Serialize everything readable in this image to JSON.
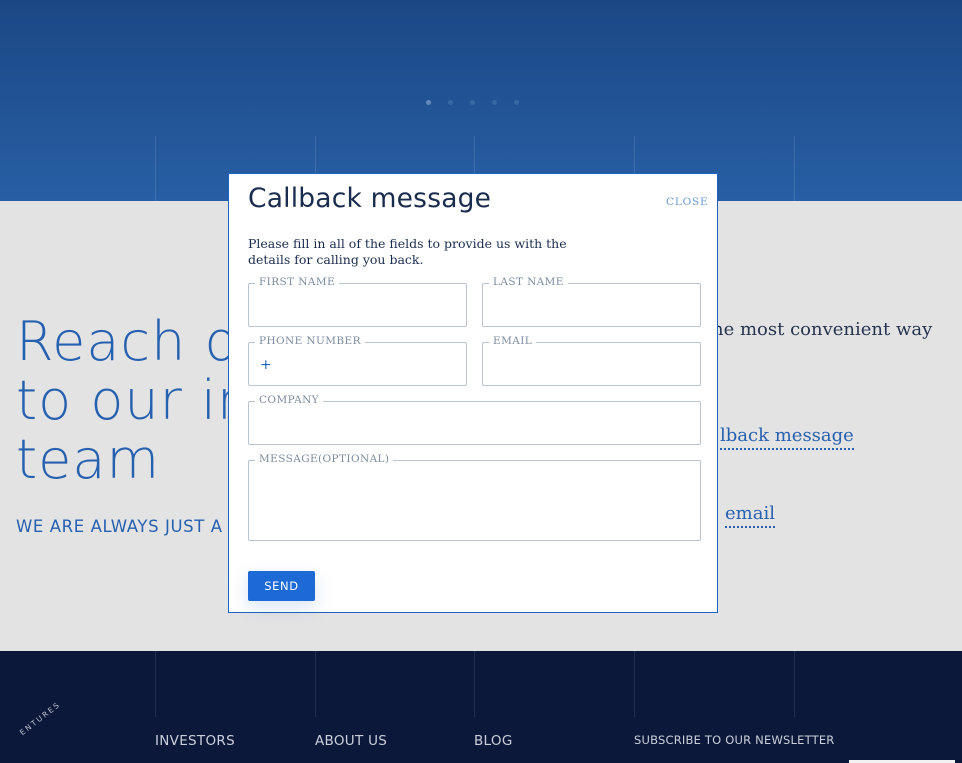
{
  "hero": {
    "slider_dots": [
      {
        "label": "slide-1",
        "active": true
      },
      {
        "label": "slide-2",
        "active": false
      },
      {
        "label": "slide-3",
        "active": false
      },
      {
        "label": "slide-4",
        "active": false
      },
      {
        "label": "slide-5",
        "active": false
      }
    ]
  },
  "contact_section": {
    "title": "Reach ou\nto our inv\nteam",
    "subtitle": "WE ARE ALWAYS JUST A C",
    "convenient_text": "he most convenient way",
    "callback_link": "lback message",
    "email_link": "email"
  },
  "modal": {
    "title": "Callback message",
    "close_label": "CLOSE",
    "description": "Please fill in all of the fields to provide us with the details for calling you back.",
    "fields": {
      "first_name": {
        "label": "FIRST NAME",
        "value": ""
      },
      "last_name": {
        "label": "LAST NAME",
        "value": ""
      },
      "phone": {
        "label": "PHONE NUMBER",
        "prefix": "+",
        "value": ""
      },
      "email": {
        "label": "EMAIL",
        "value": ""
      },
      "company": {
        "label": "COMPANY",
        "value": ""
      },
      "message": {
        "label": "MESSAGE(OPTIONAL)",
        "value": ""
      }
    },
    "send_label": "SEND"
  },
  "footer": {
    "logo_text": "ENTURES",
    "nav": [
      "INVESTORS",
      "ABOUT US",
      "BLOG"
    ],
    "newsletter_label": "SUBSCRIBE TO OUR NEWSLETTER"
  },
  "colors": {
    "accent": "#1d63c2",
    "button": "#1d6ad6",
    "hero": "#24579f",
    "footer": "#0c1a3d",
    "text_dark": "#1a2c4d"
  }
}
